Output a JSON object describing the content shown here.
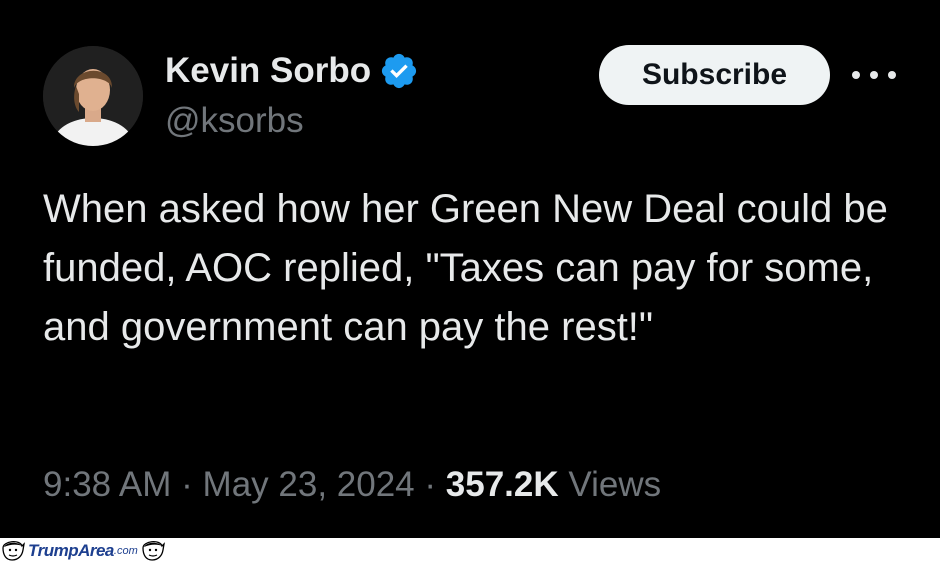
{
  "tweet": {
    "author": {
      "display_name": "Kevin Sorbo",
      "handle": "@ksorbs",
      "verified": true
    },
    "subscribe_label": "Subscribe",
    "text": "When asked how her Green New Deal could be funded, AOC replied, \"Taxes can pay for some, and government can pay the rest!\"",
    "time": "9:38 AM",
    "separator": "·",
    "date": "May 23, 2024",
    "views_count": "357.2K",
    "views_label": "Views"
  },
  "watermark": {
    "brand": "TrumpArea",
    "domain": ".com"
  },
  "colors": {
    "background": "#000000",
    "primary_text": "#e7e9ea",
    "secondary_text": "#71767b",
    "verified_blue": "#1d9bf0",
    "subscribe_bg": "#eff3f4"
  },
  "icons": {
    "verified": "verified-badge-icon",
    "more": "more-options-icon"
  }
}
